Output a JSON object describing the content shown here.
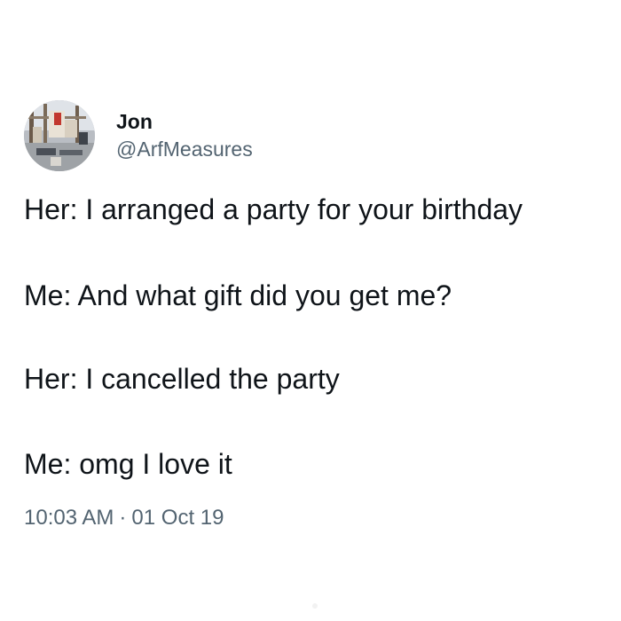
{
  "tweet": {
    "display_name": "Jon",
    "handle": "@ArfMeasures",
    "avatar_icon": "profile-photo-avatar",
    "lines": [
      "Her: I arranged a party for your birthday",
      "Me: And what gift did you get me?",
      "Her: I cancelled the party",
      "Me: omg I love it"
    ],
    "time": "10:03 AM",
    "separator": "·",
    "date": "01 Oct 19"
  },
  "colors": {
    "text_primary": "#0f1419",
    "text_secondary": "#536471",
    "background": "#ffffff"
  }
}
